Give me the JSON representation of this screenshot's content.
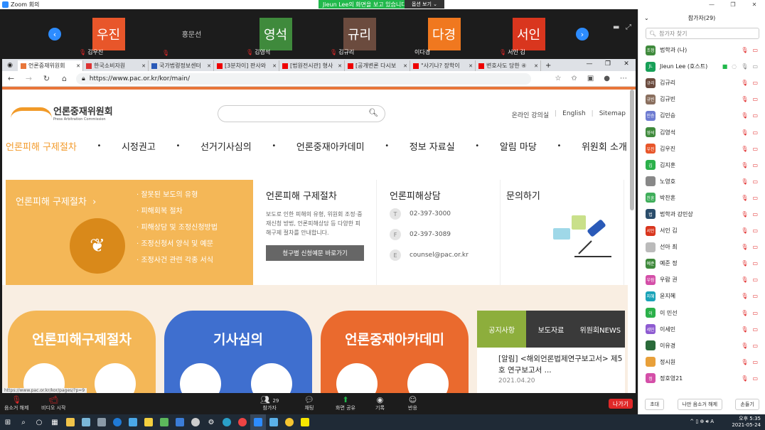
{
  "zoom": {
    "window_title": "Zoom 회의",
    "share_banner": "Jieun Lee의 화면을 보고 있습니다.",
    "view_options": "옵션 보기",
    "video_tiles": [
      {
        "avatar": "우진",
        "name": "김우진",
        "color": "#e8562a",
        "muted": true
      },
      {
        "avatar": "",
        "name": "",
        "plain": "홍문선",
        "color": "#1c1c1c",
        "muted": true
      },
      {
        "avatar": "영석",
        "name": "김영석",
        "color": "#3f8a3c",
        "muted": true
      },
      {
        "avatar": "규리",
        "name": "김규리",
        "color": "#6b4b3e",
        "muted": true
      },
      {
        "avatar": "다경",
        "name": "이다경",
        "color": "#f0781f",
        "muted": false
      },
      {
        "avatar": "서인",
        "name": "서인 김",
        "color": "#d9361e",
        "muted": true
      }
    ],
    "toolbar": {
      "unmute": "음소거 해제",
      "start_video": "비디오 시작",
      "participants": "참가자",
      "participants_count": "29",
      "chat": "채팅",
      "share": "화면 공유",
      "record": "기록",
      "reactions": "반응",
      "leave": "나가기"
    }
  },
  "browser": {
    "tabs": [
      {
        "label": "언론중재위원회",
        "active": true,
        "icon_color": "#e8763a"
      },
      {
        "label": "한국소비자원",
        "active": false,
        "icon_color": "#d33"
      },
      {
        "label": "국가법령정보센터",
        "active": false,
        "icon_color": "#2a5ab8"
      },
      {
        "label": "[3분차이] 판사와",
        "active": false,
        "icon_color": "#e00"
      },
      {
        "label": "[법원전시관] 형사",
        "active": false,
        "icon_color": "#e00"
      },
      {
        "label": "[공개변론 다시보",
        "active": false,
        "icon_color": "#e00"
      },
      {
        "label": "\"사기나? 장학이",
        "active": false,
        "icon_color": "#e00"
      },
      {
        "label": "변호사도 당한 ④",
        "active": false,
        "icon_color": "#e00"
      }
    ],
    "url": "https://www.pac.or.kr/kor/main/",
    "status_url": "https://www.pac.or.kr/kor/pages/?p=9"
  },
  "site": {
    "logo_kr": "언론중재위원회",
    "logo_en": "Press Arbitration Commission",
    "top_links": [
      "온라인 강의실",
      "English",
      "Sitemap"
    ],
    "nav": [
      "언론피해 구제절차",
      "시정권고",
      "선거기사심의",
      "언론중재아카데미",
      "정보 자료실",
      "알림 마당",
      "위원회 소개"
    ],
    "panel": {
      "title": "언론피해 구제절차",
      "list": [
        "· 잘못된 보도의 유형",
        "· 피해회복 절차",
        "· 피해상담 및 조정신청방법",
        "· 조정신청서 양식 및 예문",
        "· 조정사건 관련 각종 서식"
      ],
      "proc_title": "언론피해 구제절차",
      "proc_desc": "보도로 인한 피해의 유형, 위원회 조정·중재신청 방법, 언론피해상담 등 다양한 피해구제 절차를 안내합니다.",
      "proc_btn": "청구별 신청예문 바로가기",
      "consult_title": "언론피해상담",
      "contacts": [
        {
          "k": "T",
          "v": "02-397-3000"
        },
        {
          "k": "F",
          "v": "02-397-3089"
        },
        {
          "k": "E",
          "v": "counsel@pac.or.kr"
        }
      ],
      "inquiry_title": "문의하기"
    },
    "cards": [
      {
        "label": "언론피해구제절차",
        "color": "#f4b757"
      },
      {
        "label": "기사심의",
        "color": "#3f6fcf"
      },
      {
        "label": "언론중재아카데미",
        "color": "#ea6a2e"
      }
    ],
    "notice_tabs": [
      "공지사항",
      "보도자료",
      "위원회NEWS"
    ],
    "notice_text": "[알림] <해외언론법제연구보고서> 제5호 연구보고서 ...",
    "notice_date": "2021.04.20"
  },
  "participants": {
    "header": "참가자(29)",
    "search_placeholder": "참가자 찾기",
    "list": [
      {
        "av": "조정",
        "name": "법학과 (나)",
        "color": "#3f8a3c"
      },
      {
        "av": "JL",
        "name": "Jieun Lee (호스트)",
        "color": "#18a058",
        "host": true
      },
      {
        "av": "규리",
        "name": "김규리",
        "color": "#6b4b3e"
      },
      {
        "av": "규빈",
        "name": "김규빈",
        "color": "#8a6f5e"
      },
      {
        "av": "민승",
        "name": "김민승",
        "color": "#6d7bd1"
      },
      {
        "av": "영석",
        "name": "김영석",
        "color": "#3f8a3c"
      },
      {
        "av": "우진",
        "name": "김우진",
        "color": "#e8562a"
      },
      {
        "av": "김",
        "name": "김지훈",
        "color": "#2bb04a"
      },
      {
        "av": "",
        "name": "노영호",
        "color": "#888"
      },
      {
        "av": "찬혼",
        "name": "박찬혼",
        "color": "#3fae5a"
      },
      {
        "av": "법",
        "name": "법학과 강민상",
        "color": "#2a4d6b"
      },
      {
        "av": "서인",
        "name": "서인 김",
        "color": "#d9361e"
      },
      {
        "av": "",
        "name": "선아 최",
        "color": "#bbb"
      },
      {
        "av": "예준",
        "name": "예준 정",
        "color": "#3f8a3c"
      },
      {
        "av": "우람",
        "name": "우람 권",
        "color": "#d44fa8"
      },
      {
        "av": "지혜",
        "name": "윤지혜",
        "color": "#1aa3b8"
      },
      {
        "av": "이",
        "name": "이 민선",
        "color": "#2bb04a"
      },
      {
        "av": "세민",
        "name": "이세민",
        "color": "#8e5bd1"
      },
      {
        "av": "",
        "name": "이유경",
        "color": "#2a6a3a"
      },
      {
        "av": "",
        "name": "정시원",
        "color": "#e8a03a"
      },
      {
        "av": "정",
        "name": "정호영21",
        "color": "#d44fa8"
      }
    ],
    "invite": "초대",
    "unmute_me": "나만 음소거 해제",
    "raise_hand": "손들기"
  },
  "taskbar": {
    "time": "오후 5:35",
    "date": "2021-05-24",
    "lang": "A"
  }
}
